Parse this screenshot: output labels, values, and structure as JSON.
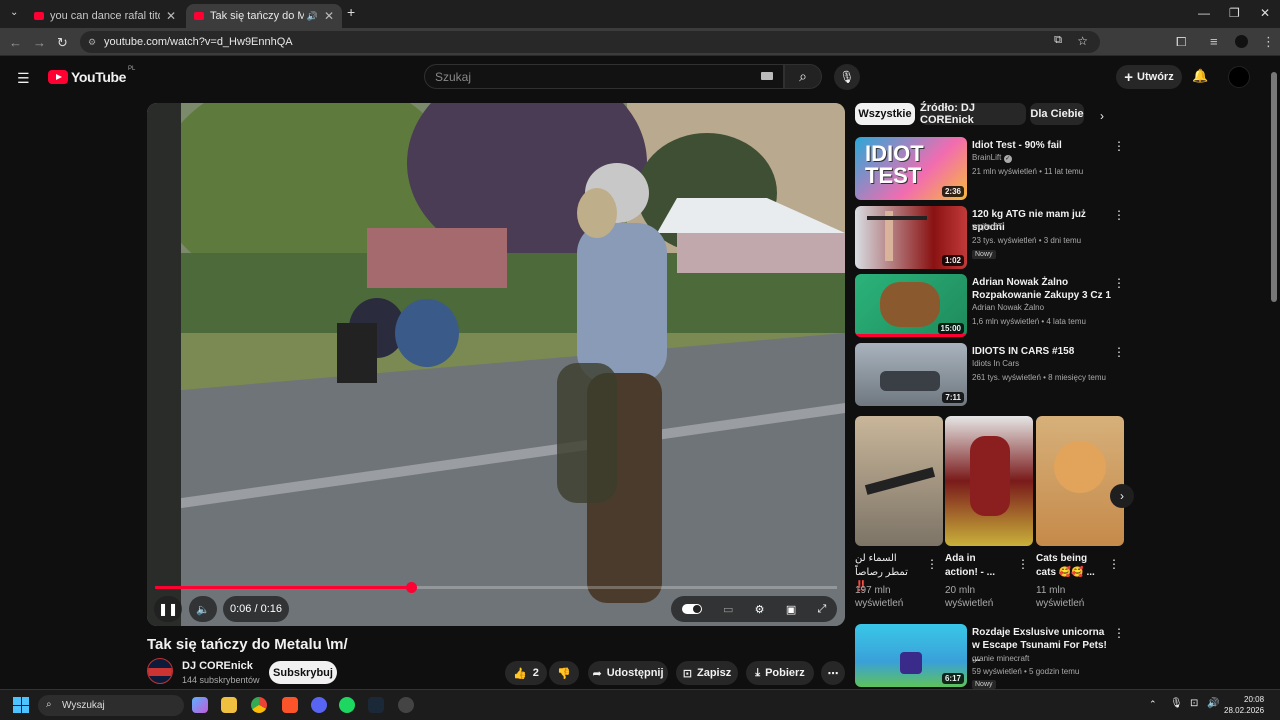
{
  "browser": {
    "tabs": [
      {
        "title": "you can dance rafal tito - YouTube",
        "active": false
      },
      {
        "title": "Tak się tańczy do Metalu \\m/",
        "active": true
      }
    ],
    "url": "youtube.com/watch?v=d_Hw9EnnhQA"
  },
  "header": {
    "logo": "YouTube",
    "region": "PL",
    "search_placeholder": "Szukaj",
    "create_label": "Utwórz"
  },
  "player": {
    "time": "0:06 / 0:16",
    "progress": 0.375
  },
  "video": {
    "title": "Tak się tańczy do Metalu \\m/",
    "channel": "DJ COREnick",
    "subscribers": "144 subskrybentów",
    "subscribe_label": "Subskrybuj",
    "likes": "2",
    "share_label": "Udostępnij",
    "save_label": "Zapisz",
    "download_label": "Pobierz"
  },
  "chips": [
    "Wszystkie",
    "Źródło: DJ COREnick",
    "Dla Ciebie"
  ],
  "recommended": [
    {
      "title": "Idiot Test - 90% fail",
      "channel": "BrainLift",
      "verified": true,
      "meta": "21 mln wyświetleń • 11 lat temu",
      "duration": "2:36",
      "badge": ""
    },
    {
      "title": "120 kg ATG nie mam już spodni",
      "channel": "wojfer87",
      "verified": false,
      "meta": "23 tys. wyświetleń • 3 dni temu",
      "duration": "1:02",
      "badge": "Nowy"
    },
    {
      "title": "Adrian Nowak Żalno Rozpakowanie Zakupy 3 Cz 1",
      "channel": "Adrian Nowak Żalno",
      "verified": false,
      "meta": "1,6 mln wyświetleń • 4 lata temu",
      "duration": "15:00",
      "badge": ""
    },
    {
      "title": "IDIOTS IN CARS #158",
      "channel": "Idiots In Cars",
      "verified": false,
      "meta": "261 tys. wyświetleń • 8 miesięcy temu",
      "duration": "7:11",
      "badge": ""
    }
  ],
  "shorts": [
    {
      "title": "السماء لن تمطر رصاصاً ‼️",
      "views": "197 mln wyświetleń"
    },
    {
      "title": "Ada in action! - ...",
      "views": "20 mln wyświetleń"
    },
    {
      "title": "Cats being cats 🥰🥰 ...",
      "views": "11 mln wyświetleń"
    }
  ],
  "recommended_bottom": {
    "title": "Rozdaje Exslusive unicorna w Escape Tsunami For Pets! ...",
    "channel": "granie minecraft",
    "meta": "59 wyświetleń • 5 godzin temu",
    "duration": "6:17",
    "badge": "Nowy"
  },
  "taskbar": {
    "search_placeholder": "Wyszukaj",
    "time": "20:08",
    "date": "28.02.2026"
  }
}
